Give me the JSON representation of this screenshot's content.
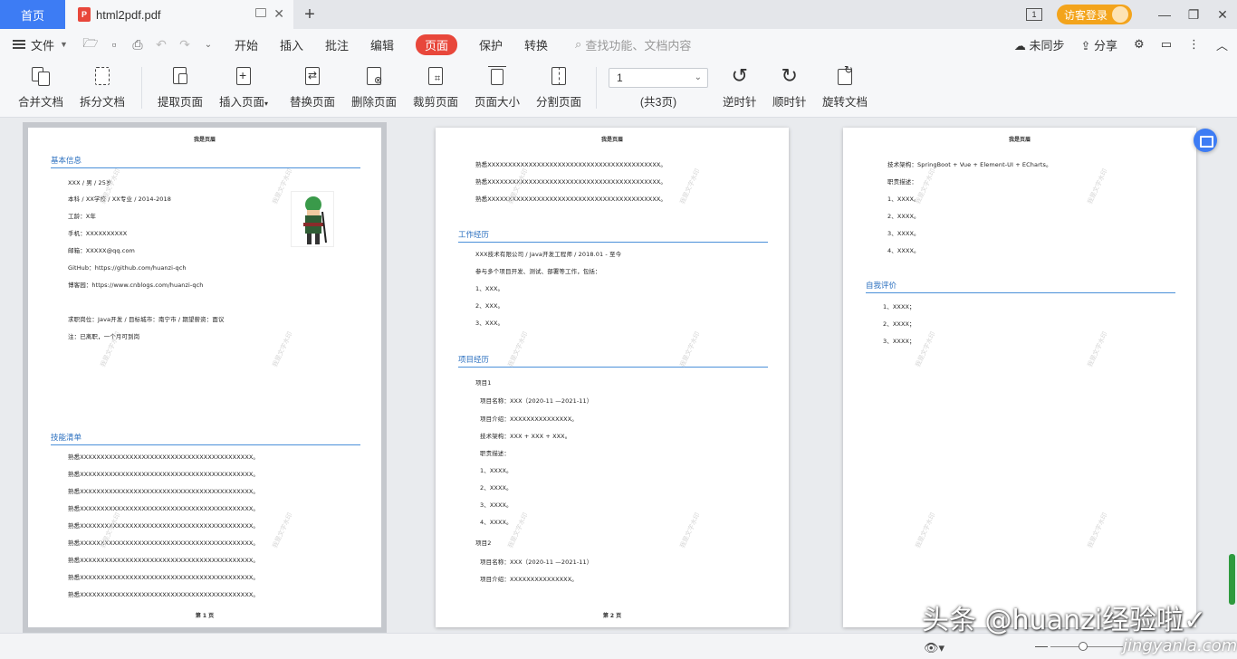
{
  "tabs": {
    "home": "首页",
    "doc": "html2pdf.pdf",
    "pdf_badge": "P"
  },
  "titlebar": {
    "login": "访客登录",
    "page_indicator": "1"
  },
  "menu": {
    "file": "文件",
    "items": [
      "开始",
      "插入",
      "批注",
      "编辑",
      "页面",
      "保护",
      "转换"
    ],
    "search": "查找功能、文档内容",
    "sync": "未同步",
    "share": "分享"
  },
  "ribbon": {
    "merge": "合并文档",
    "split": "拆分文档",
    "extract": "提取页面",
    "insert": "插入页面",
    "replace": "替换页面",
    "delete": "删除页面",
    "crop": "裁剪页面",
    "size": "页面大小",
    "divide": "分割页面",
    "page_value": "1",
    "page_total": "(共3页)",
    "ccw": "逆时针",
    "cw": "顺时针",
    "rotate": "旋转文档"
  },
  "doc": {
    "header": "我是页眉",
    "watermark": "我是文字水印",
    "p1": {
      "footer": "第 1 页",
      "sec1": "基本信息",
      "info": [
        "XXX / 男 / 25岁",
        "本科 / XX学校 / XX专业 / 2014-2018",
        "工龄：X年",
        "手机：XXXXXXXXXX",
        "邮箱：XXXXX@qq.com",
        "GitHub：https://github.com/huanzi-qch",
        "博客园：https://www.cnblogs.com/huanzi-qch"
      ],
      "job": "求职岗位：Java开发 / 目标城市：南宁市 / 期望薪资：面议",
      "note": "注：已离职，一个月可到岗",
      "sec2": "技能清单",
      "skills": [
        "熟悉XXXXXXXXXXXXXXXXXXXXXXXXXXXXXXXXXXXXXXXXXX。",
        "熟悉XXXXXXXXXXXXXXXXXXXXXXXXXXXXXXXXXXXXXXXXXX。",
        "熟悉XXXXXXXXXXXXXXXXXXXXXXXXXXXXXXXXXXXXXXXXXX。",
        "熟悉XXXXXXXXXXXXXXXXXXXXXXXXXXXXXXXXXXXXXXXXXX。",
        "熟悉XXXXXXXXXXXXXXXXXXXXXXXXXXXXXXXXXXXXXXXXXX。",
        "熟悉XXXXXXXXXXXXXXXXXXXXXXXXXXXXXXXXXXXXXXXXXX。",
        "熟悉XXXXXXXXXXXXXXXXXXXXXXXXXXXXXXXXXXXXXXXXXX。",
        "熟悉XXXXXXXXXXXXXXXXXXXXXXXXXXXXXXXXXXXXXXXXXX。",
        "熟悉XXXXXXXXXXXXXXXXXXXXXXXXXXXXXXXXXXXXXXXXXX。"
      ]
    },
    "p2": {
      "footer": "第 2 页",
      "top": [
        "熟悉XXXXXXXXXXXXXXXXXXXXXXXXXXXXXXXXXXXXXXXXXX。",
        "熟悉XXXXXXXXXXXXXXXXXXXXXXXXXXXXXXXXXXXXXXXXXX。",
        "熟悉XXXXXXXXXXXXXXXXXXXXXXXXXXXXXXXXXXXXXXXXXX。"
      ],
      "sec1": "工作经历",
      "work": [
        "XXX技术有限公司 / Java开发工程师 / 2018.01 - 至今",
        "参与多个项目开发、测试、部署等工作，包括：",
        "1、XXX。",
        "2、XXX。",
        "3、XXX。"
      ],
      "sec2": "项目经历",
      "proj": [
        "项目1",
        "项目名称：XXX（2020-11 —2021-11）",
        "项目介绍：XXXXXXXXXXXXXXX。",
        "技术架构：XXX + XXX + XXX。",
        "职责描述：",
        "1、XXXX。",
        "2、XXXX。",
        "3、XXXX。",
        "4、XXXX。",
        "项目2",
        "项目名称：XXX（2020-11 —2021-11）",
        "项目介绍：XXXXXXXXXXXXXXX。"
      ]
    },
    "p3": {
      "top": [
        "技术架构：SpringBoot + Vue + Element-UI + ECharts。",
        "职责描述：",
        "1、XXXX。",
        "2、XXXX。",
        "3、XXXX。",
        "4、XXXX。"
      ],
      "sec1": "自我评价",
      "eval": [
        "1、XXXX；",
        "2、XXXX；",
        "3、XXXX；"
      ]
    }
  },
  "overlay": {
    "brand": "头条 @huanzi经验啦✓",
    "brand2": "jingyanla.com"
  }
}
